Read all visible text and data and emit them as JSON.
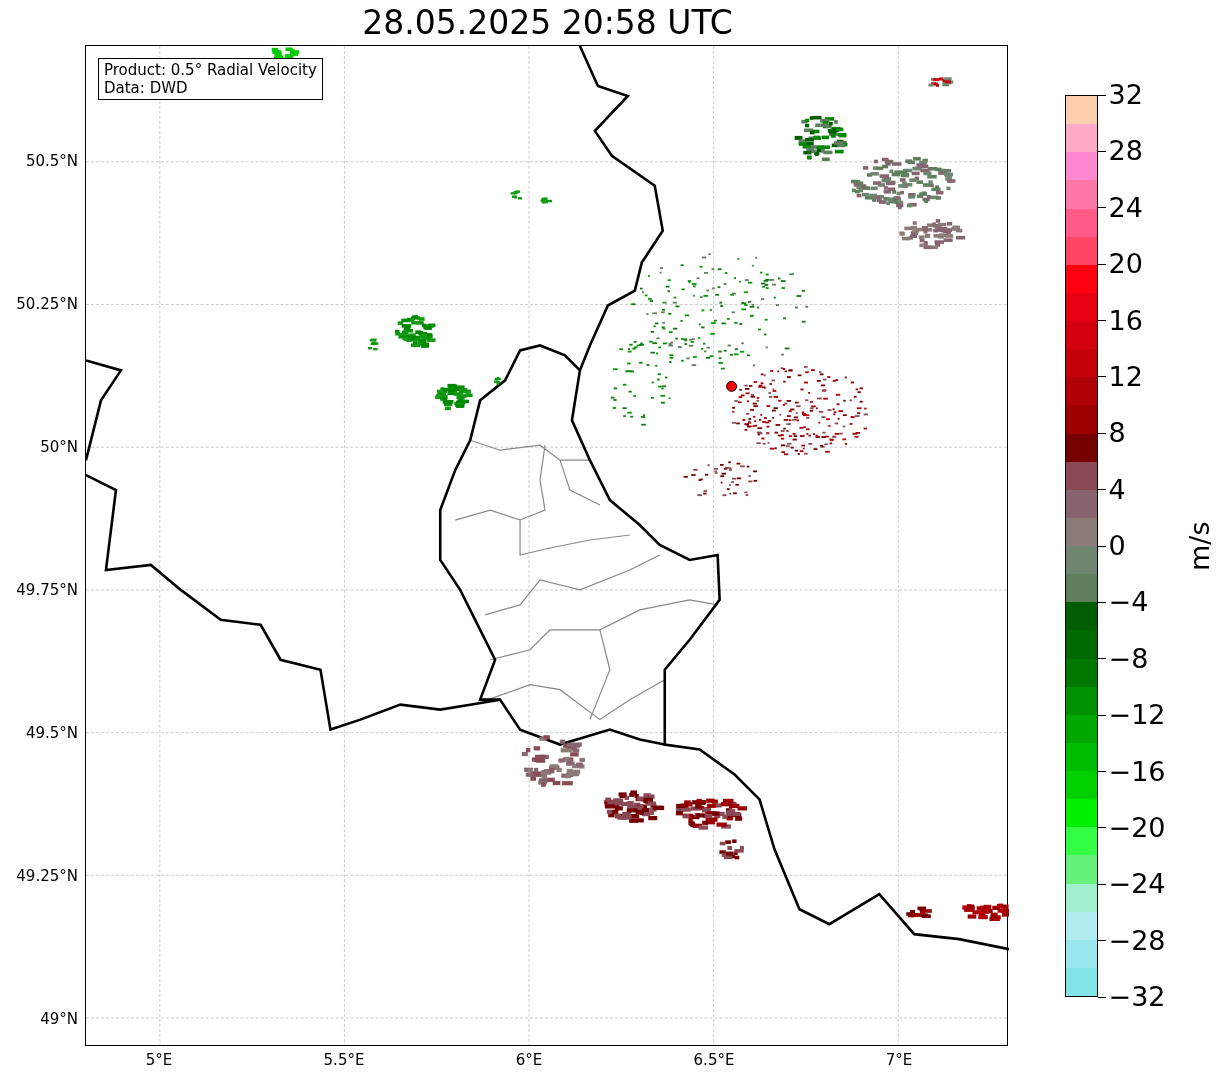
{
  "title": "28.05.2025 20:58 UTC",
  "legend": {
    "lines": [
      "Product: 0.5° Radial Velocity",
      "Data: DWD"
    ]
  },
  "map": {
    "xticks": [
      "5°E",
      "5.5°E",
      "6°E",
      "6.5°E",
      "7°E"
    ],
    "yticks": [
      "50.5°N",
      "50.25°N",
      "50°N",
      "49.75°N",
      "49.5°N",
      "49.25°N",
      "49°N"
    ]
  },
  "colorbar": {
    "label": "m/s",
    "ticks": [
      "32",
      "28",
      "24",
      "20",
      "16",
      "12",
      "8",
      "4",
      "0",
      "−4",
      "−8",
      "−12",
      "−16",
      "−20",
      "−24",
      "−28",
      "−32"
    ],
    "segments": [
      {
        "color": "#ffd0b0"
      },
      {
        "color": "#ffaac8"
      },
      {
        "color": "#ff88d0"
      },
      {
        "color": "#ff77a8"
      },
      {
        "color": "#ff5a88"
      },
      {
        "color": "#ff4466"
      },
      {
        "color": "#ff0010"
      },
      {
        "color": "#e60010"
      },
      {
        "color": "#d40010"
      },
      {
        "color": "#c40008"
      },
      {
        "color": "#b00008"
      },
      {
        "color": "#9c0000"
      },
      {
        "color": "#740000"
      },
      {
        "color": "#8a4a55"
      },
      {
        "color": "#876470"
      },
      {
        "color": "#8a7a78"
      },
      {
        "color": "#6e8670"
      },
      {
        "color": "#5e7e5e"
      },
      {
        "color": "#005e00"
      },
      {
        "color": "#006a00"
      },
      {
        "color": "#007800"
      },
      {
        "color": "#009000"
      },
      {
        "color": "#00a800"
      },
      {
        "color": "#00bc00"
      },
      {
        "color": "#00d000"
      },
      {
        "color": "#00f000"
      },
      {
        "color": "#33ff44"
      },
      {
        "color": "#66f27a"
      },
      {
        "color": "#a0f0d0"
      },
      {
        "color": "#b0ecf0"
      },
      {
        "color": "#98e8ee"
      },
      {
        "color": "#80e4e8"
      }
    ]
  }
}
